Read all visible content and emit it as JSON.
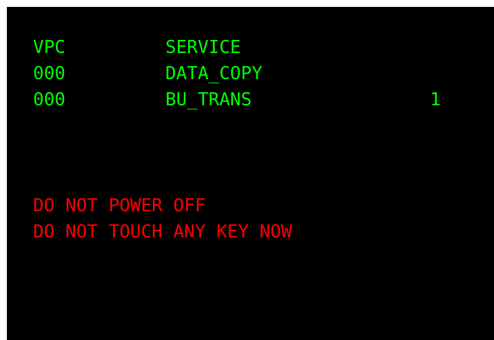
{
  "header": {
    "vpc_label": "VPC",
    "service_label": "SERVICE"
  },
  "rows": [
    {
      "vpc": "000",
      "service": "DATA_COPY",
      "count": ""
    },
    {
      "vpc": "000",
      "service": "BU_TRANS",
      "count": "1"
    }
  ],
  "warnings": [
    "DO NOT POWER OFF",
    "DO NOT TOUCH ANY KEY NOW"
  ],
  "colors": {
    "background": "#000000",
    "status_text": "#00ff00",
    "warning_text": "#ff0000"
  }
}
